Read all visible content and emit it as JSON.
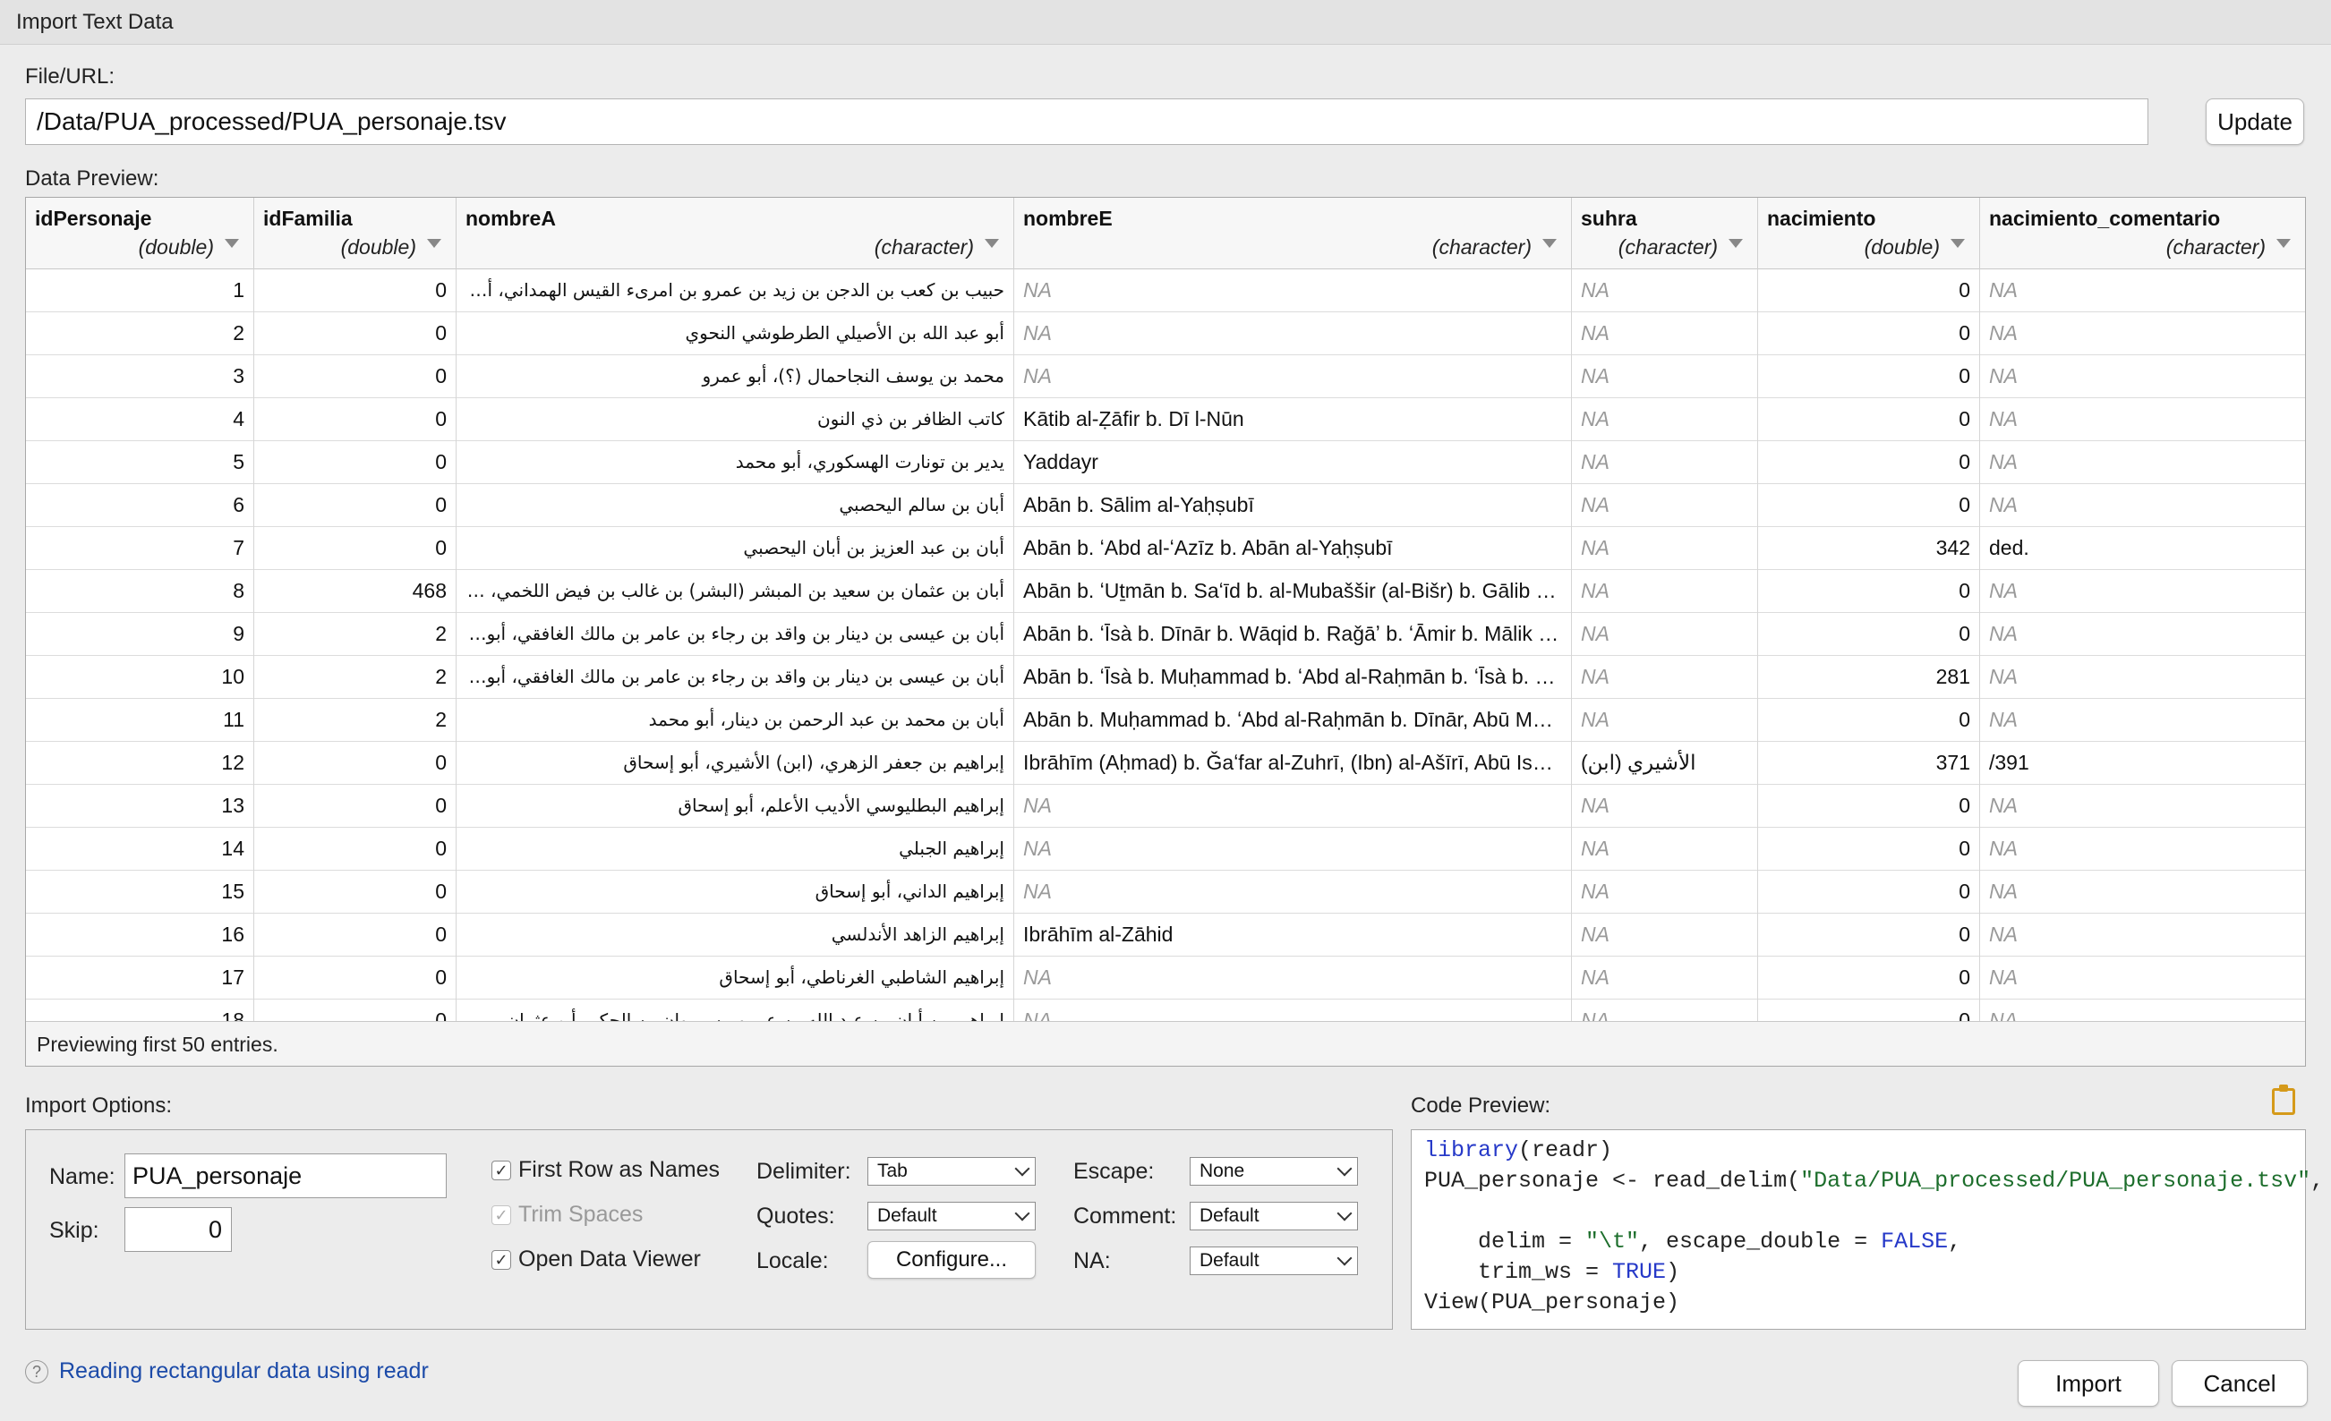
{
  "window": {
    "title": "Import Text Data"
  },
  "file": {
    "label": "File/URL:",
    "value": "/Data/PUA_processed/PUA_personaje.tsv",
    "update_label": "Update"
  },
  "preview": {
    "label": "Data Preview:",
    "footer": "Previewing first 50 entries.",
    "columns": [
      {
        "name": "idPersonaje",
        "type": "(double)"
      },
      {
        "name": "idFamilia",
        "type": "(double)"
      },
      {
        "name": "nombreA",
        "type": "(character)"
      },
      {
        "name": "nombreE",
        "type": "(character)"
      },
      {
        "name": "suhra",
        "type": "(character)"
      },
      {
        "name": "nacimiento",
        "type": "(double)"
      },
      {
        "name": "nacimiento_comentario",
        "type": "(character)"
      }
    ],
    "rows": [
      [
        "1",
        "0",
        "حبيب بن كعب بن الدجن بن زيد بن عمرو بن امرىء القيس الهمداني، أبو محمد",
        "NA",
        "NA",
        "0",
        "NA"
      ],
      [
        "2",
        "0",
        "أبو عبد الله بن الأصيلي الطرطوشي النحوي",
        "NA",
        "NA",
        "0",
        "NA"
      ],
      [
        "3",
        "0",
        "محمد بن يوسف النجاحمال (؟)، أبو عمرو",
        "NA",
        "NA",
        "0",
        "NA"
      ],
      [
        "4",
        "0",
        "كاتب الظافر بن ذي النون",
        "Kātib al-Ẓāfir b. Dī l-Nūn",
        "NA",
        "0",
        "NA"
      ],
      [
        "5",
        "0",
        "يدير بن تونارت الهسكوري، أبو محمد",
        "Yaddayr",
        "NA",
        "0",
        "NA"
      ],
      [
        "6",
        "0",
        "أبان بن سالم اليحصبي",
        "Abān b. Sālim al-Yaḥṣubī",
        "NA",
        "0",
        "NA"
      ],
      [
        "7",
        "0",
        "أبان بن عبد العزيز بن أبان اليحصبي",
        "Abān b. ʻAbd al-ʻAzīz b. Abān al-Yaḥṣubī",
        "NA",
        "342",
        "ded."
      ],
      [
        "8",
        "468",
        "أبان بن عثمان بن سعيد بن المبشر (البشر) بن غالب بن فيض اللخمي، أبو الوليد",
        "Abān b. ʻUṯmān b. Saʻīd b. al-Mubaššir (al-Bišr) b. Gālib b. Fayḍ al-Lajmī",
        "NA",
        "0",
        "NA"
      ],
      [
        "9",
        "2",
        "أبان بن عيسى بن دينار بن واقد بن رجاء بن عامر بن مالك الغافقي، أبو القاسم",
        "Abān b. ʻĪsà b. Dīnār b. Wāqid b. Raǧāʼ b. ʻĀmir b. Mālik al-Gāfiqī",
        "NA",
        "0",
        "NA"
      ],
      [
        "10",
        "2",
        "أبان بن عيسى بن دينار بن واقد بن رجاء بن عامر بن مالك الغافقي، أبو محمد، أبو القاسم",
        "Abān b. ʻĪsà b. Muḥammad b. ʻAbd al-Raḥmān b. ʻĪsà b. Dīnār",
        "NA",
        "281",
        "NA"
      ],
      [
        "11",
        "2",
        "أبان بن محمد بن عبد الرحمن بن دينار، أبو محمد",
        "Abān b. Muḥammad b. ʻAbd al-Raḥmān b. Dīnār, Abū Muḥammad",
        "NA",
        "0",
        "NA"
      ],
      [
        "12",
        "0",
        "إبراهيم بن جعفر الزهري، (ابن) الأشيري، أبو إسحاق",
        "Ibrāhīm (Aḥmad) b. Ǧaʻfar al-Zuhrī, (Ibn) al-Ašīrī, Abū Isḥāq",
        "(ابن) الأشيري",
        "371",
        "/391"
      ],
      [
        "13",
        "0",
        "إبراهيم البطليوسي الأديب الأعلم، أبو إسحاق",
        "NA",
        "NA",
        "0",
        "NA"
      ],
      [
        "14",
        "0",
        "إبراهيم الجبلي",
        "NA",
        "NA",
        "0",
        "NA"
      ],
      [
        "15",
        "0",
        "إبراهيم الداني، أبو إسحاق",
        "NA",
        "NA",
        "0",
        "NA"
      ],
      [
        "16",
        "0",
        "إبراهيم الزاهد الأندلسي",
        "Ibrāhīm al-Zāhid",
        "NA",
        "0",
        "NA"
      ],
      [
        "17",
        "0",
        "إبراهيم الشاطبي الغرناطي، أبو إسحاق",
        "NA",
        "NA",
        "0",
        "NA"
      ],
      [
        "18",
        "0",
        "إبراهيم بن أبان بن عبد الله بن عمرو بن مروان بن الحكم، أبو عثمان",
        "NA",
        "NA",
        "0",
        "NA"
      ]
    ]
  },
  "import_options": {
    "label": "Import Options:",
    "name_label": "Name:",
    "name_value": "PUA_personaje",
    "skip_label": "Skip:",
    "skip_value": "0",
    "first_row_label": "First Row as Names",
    "trim_spaces_label": "Trim Spaces",
    "open_viewer_label": "Open Data Viewer",
    "delimiter_label": "Delimiter:",
    "delimiter_value": "Tab",
    "quotes_label": "Quotes:",
    "quotes_value": "Default",
    "locale_label": "Locale:",
    "configure_label": "Configure...",
    "escape_label": "Escape:",
    "escape_value": "None",
    "comment_label": "Comment:",
    "comment_value": "Default",
    "na_label": "NA:",
    "na_value": "Default"
  },
  "code_preview": {
    "label": "Code Preview:",
    "l1_kw": "library",
    "l1_rest": "(readr)",
    "l2_a": "PUA_personaje <- read_delim(",
    "l2_str": "\"Data/PUA_processed/PUA_personaje.tsv\"",
    "l2_b": ",",
    "l3_a": "    delim = ",
    "l3_str": "\"\\t\"",
    "l3_b": ", escape_double = ",
    "l3_kw": "FALSE",
    "l3_c": ",",
    "l4_a": "    trim_ws = ",
    "l4_kw": "TRUE",
    "l4_b": ")",
    "l5": "View(PUA_personaje)"
  },
  "footer": {
    "help_label": "Reading rectangular data using readr",
    "import_label": "Import",
    "cancel_label": "Cancel"
  }
}
